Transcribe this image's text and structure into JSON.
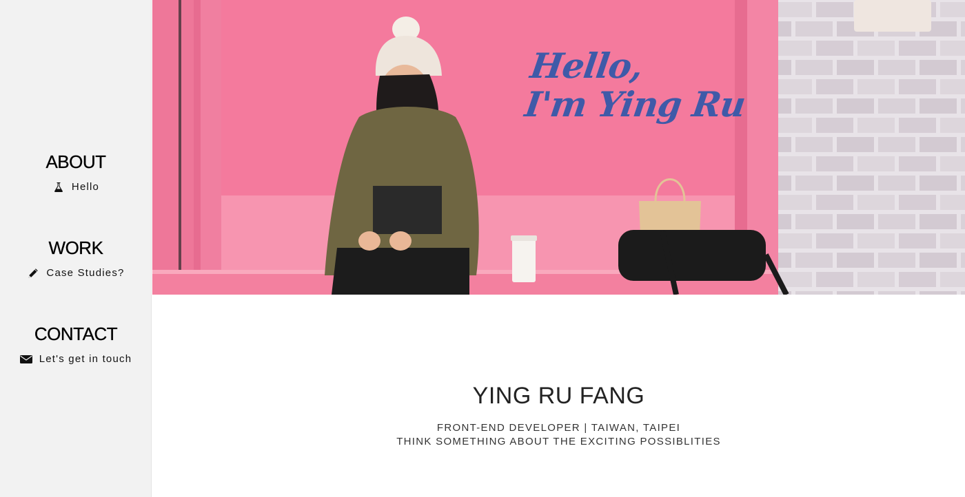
{
  "sidebar": {
    "about": {
      "title": "ABOUT",
      "link": "Hello",
      "icon": "flask-icon"
    },
    "work": {
      "title": "WORK",
      "link": "Case Studies?",
      "icon": "pencil-icon"
    },
    "contact": {
      "title": "CONTACT",
      "link": "Let's get in touch",
      "icon": "envelope-icon"
    }
  },
  "hero": {
    "greeting_line1": "Hello,",
    "greeting_line2": "I'm Ying Ru",
    "greeting_color": "#3f5aa8",
    "wall_color": "#f07fa0"
  },
  "profile": {
    "name": "YING RU FANG",
    "role_line": "FRONT-END DEVELOPER | TAIWAN, TAIPEI",
    "tagline": "THINK SOMETHING ABOUT THE EXCITING POSSIBLITIES"
  }
}
